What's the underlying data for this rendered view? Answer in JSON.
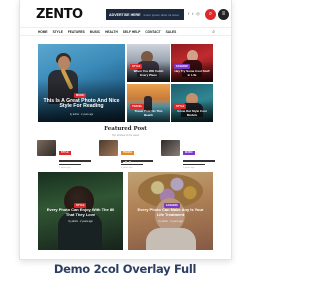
{
  "header": {
    "logo": "ZENTO",
    "ad_title": "Advertise here",
    "ad_text": "lorem ipsum dolor sit amet",
    "social_icons": [
      "facebook-icon",
      "twitter-icon",
      "instagram-icon",
      "pinterest-icon"
    ],
    "search_icon": "search-icon",
    "menu_icon": "menu-icon"
  },
  "nav": {
    "items": [
      "Home",
      "Style",
      "Features",
      "Music",
      "Health",
      "Self Help",
      "Contact",
      "Sales"
    ],
    "search_glyph": "⌕"
  },
  "hero": {
    "main": {
      "tag": "Music",
      "title": "This Is A Great Photo And Nice Style For Reading",
      "meta": "by admin · 2 years ago"
    },
    "top_a": {
      "tag": "Style",
      "title": "When You Will Catch Every Place"
    },
    "top_b": {
      "tag": "Fashion",
      "title": "Hey Try Some Cool Stuff in Life"
    },
    "bot_a": {
      "tag": "Travel",
      "title": "Travel Post On This Beach"
    },
    "bot_b": {
      "tag": "Style",
      "title": "Grow Out Style Cool Models"
    }
  },
  "featured": {
    "title": "Featured Post",
    "subtitle": "Top articles of the week",
    "items": [
      {
        "tag": "Style",
        "meta": "2 years ago",
        "tag_color": "#e0272a",
        "thumb": "linear-gradient(135deg,#7b6a5a,#2f2a28)"
      },
      {
        "tag": "Travel",
        "meta": "2 years ago",
        "tag_color": "#e08a27",
        "thumb": "linear-gradient(135deg,#4a3a30,#a57b58)"
      },
      {
        "tag": "Music",
        "meta": "2 years ago",
        "tag_color": "#7a39c8",
        "thumb": "linear-gradient(135deg,#2c2a2a,#8d8076)"
      }
    ]
  },
  "cards": {
    "a": {
      "tag": "Style",
      "title": "Every Photo Can Enjoy With The 80 That They Love",
      "meta": "by admin · 2 years ago"
    },
    "b": {
      "tag": "Fashion",
      "title": "Every Photo Can Make Any Is Your Life Treatment",
      "meta": "by admin · 2 years ago"
    }
  },
  "caption": "Demo 2col Overlay Full",
  "colors": {
    "accent": "#e0272a",
    "caption": "#2b3f63"
  }
}
